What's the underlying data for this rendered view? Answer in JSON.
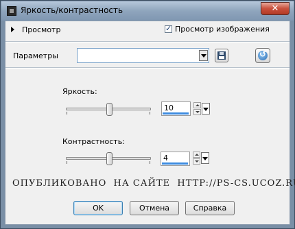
{
  "window": {
    "title": "Яркость/контрастность",
    "close_label": "✕"
  },
  "preview": {
    "label": "Просмотр",
    "checkbox_label": "Просмотр изображения",
    "checked": true
  },
  "params": {
    "label": "Параметры",
    "value": ""
  },
  "brightness": {
    "label": "Яркость:",
    "value": "10"
  },
  "contrast": {
    "label": "Контрастность:",
    "value": "4"
  },
  "watermark": "ОПУБЛИКОВАНО  НА САЙТЕ  HTTP://PS-CS.UCOZ.RU",
  "buttons": {
    "ok": "OK",
    "cancel": "Отмена",
    "help": "Справка"
  }
}
